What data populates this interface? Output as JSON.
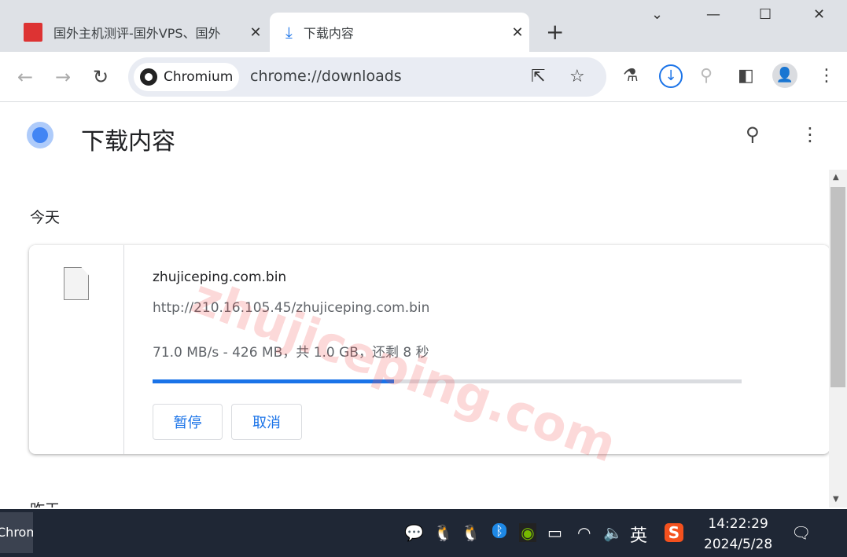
{
  "browser": {
    "tabs": [
      {
        "label": "国外主机测评-国外VPS、国外",
        "active": false
      },
      {
        "label": "下载内容",
        "active": true
      }
    ],
    "brand_chip": "Chromium",
    "url": "chrome://downloads"
  },
  "page": {
    "title": "下载内容",
    "sections": [
      {
        "label": "今天",
        "items": [
          {
            "filename": "zhujiceping.com.bin",
            "url": "http://210.16.105.45/zhujiceping.com.bin",
            "status": "71.0 MB/s - 426 MB，共 1.0 GB，还剩 8 秒",
            "progress": 0.41,
            "buttons": {
              "pause": "暂停",
              "cancel": "取消"
            }
          }
        ]
      },
      {
        "label": "昨天"
      }
    ],
    "watermark": "zhujiceping.com"
  },
  "colors": {
    "accent": "#1a73e8"
  },
  "taskbar": {
    "app": "Chromium",
    "ime": "英",
    "time": "14:22:29",
    "date": "2024/5/28"
  }
}
